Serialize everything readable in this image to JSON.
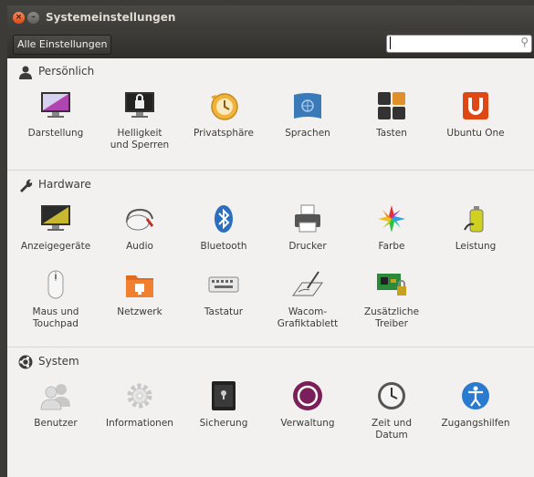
{
  "window": {
    "title": "Systemeinstellungen"
  },
  "toolbar": {
    "all_settings_label": "Alle Einstellungen",
    "search_value": "",
    "search_placeholder": ""
  },
  "sections": {
    "personal": {
      "title": "Persönlich",
      "items": [
        {
          "label": "Darstellung",
          "icon": "appearance-icon"
        },
        {
          "label": "Helligkeit\nund Sperren",
          "icon": "brightness-lock-icon"
        },
        {
          "label": "Privatsphäre",
          "icon": "privacy-icon"
        },
        {
          "label": "Sprachen",
          "icon": "language-icon"
        },
        {
          "label": "Tasten",
          "icon": "keys-icon"
        },
        {
          "label": "Ubuntu One",
          "icon": "ubuntu-one-icon"
        }
      ]
    },
    "hardware": {
      "title": "Hardware",
      "items": [
        {
          "label": "Anzeigegeräte",
          "icon": "display-icon"
        },
        {
          "label": "Audio",
          "icon": "audio-icon"
        },
        {
          "label": "Bluetooth",
          "icon": "bluetooth-icon"
        },
        {
          "label": "Drucker",
          "icon": "printer-icon"
        },
        {
          "label": "Farbe",
          "icon": "color-icon"
        },
        {
          "label": "Leistung",
          "icon": "power-icon"
        },
        {
          "label": "Maus und\nTouchpad",
          "icon": "mouse-icon"
        },
        {
          "label": "Netzwerk",
          "icon": "network-icon"
        },
        {
          "label": "Tastatur",
          "icon": "keyboard-icon"
        },
        {
          "label": "Wacom-\nGrafiktablett",
          "icon": "wacom-icon"
        },
        {
          "label": "Zusätzliche\nTreiber",
          "icon": "drivers-icon"
        }
      ]
    },
    "system": {
      "title": "System",
      "items": [
        {
          "label": "Benutzer",
          "icon": "users-icon"
        },
        {
          "label": "Informationen",
          "icon": "info-gear-icon"
        },
        {
          "label": "Sicherung",
          "icon": "backup-safe-icon"
        },
        {
          "label": "Verwaltung",
          "icon": "admin-icon"
        },
        {
          "label": "Zeit und\nDatum",
          "icon": "clock-icon"
        },
        {
          "label": "Zugangshilfen",
          "icon": "accessibility-icon"
        }
      ]
    }
  }
}
